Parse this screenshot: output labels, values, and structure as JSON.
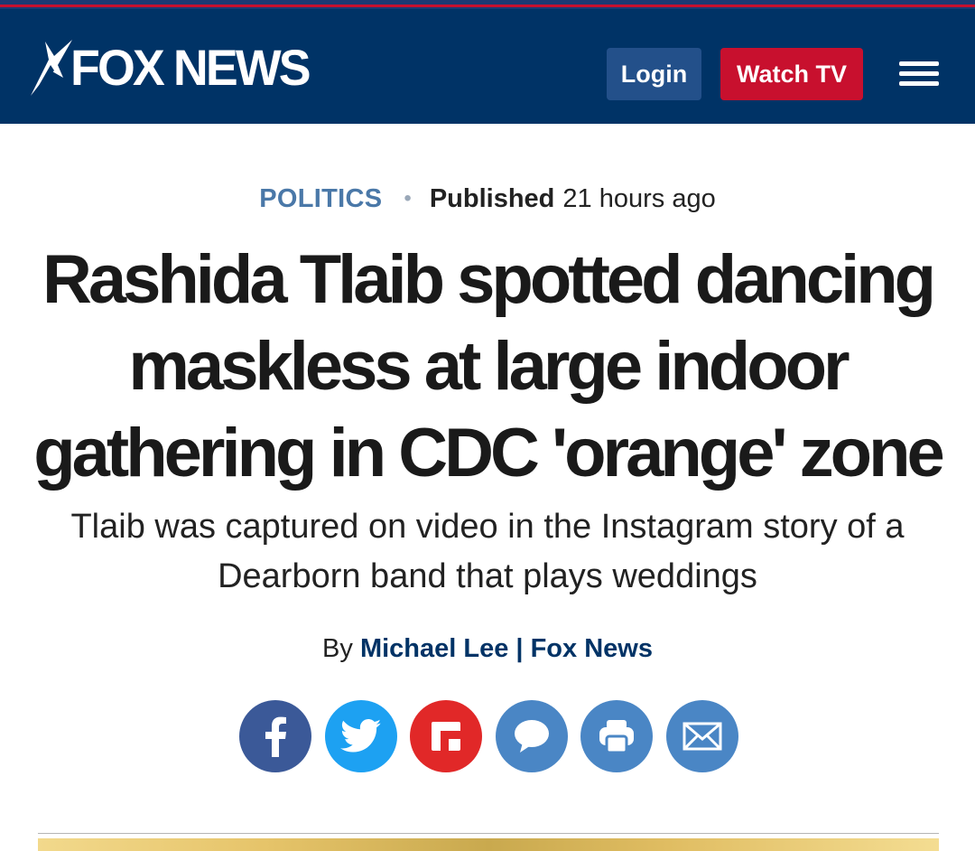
{
  "header": {
    "logo_text": "FOX NEWS",
    "login_label": "Login",
    "watch_tv_label": "Watch TV",
    "menu_icon": "hamburger-menu-icon",
    "colors": {
      "header_bg": "#003366",
      "login_bg": "#23508a",
      "watch_bg": "#c8102e"
    }
  },
  "article": {
    "category": "POLITICS",
    "separator": "•",
    "published_label": "Published",
    "published_time": "21 hours ago",
    "headline": "Rashida Tlaib spotted dancing maskless at large indoor gathering in CDC 'orange' zone",
    "subheadline": "Tlaib was captured on video in the Instagram story of a Dearborn band that plays weddings",
    "byline": {
      "prefix": "By",
      "author": "Michael Lee",
      "separator": "|",
      "source": "Fox News"
    }
  },
  "share": [
    {
      "name": "facebook",
      "icon": "facebook-icon",
      "color": "#3b5998"
    },
    {
      "name": "twitter",
      "icon": "twitter-icon",
      "color": "#1da1f2"
    },
    {
      "name": "flipboard",
      "icon": "flipboard-icon",
      "color": "#e12828"
    },
    {
      "name": "comments",
      "icon": "comment-icon",
      "color": "#4a86c5"
    },
    {
      "name": "print",
      "icon": "print-icon",
      "color": "#4a86c5"
    },
    {
      "name": "email",
      "icon": "email-icon",
      "color": "#4a86c5"
    }
  ]
}
